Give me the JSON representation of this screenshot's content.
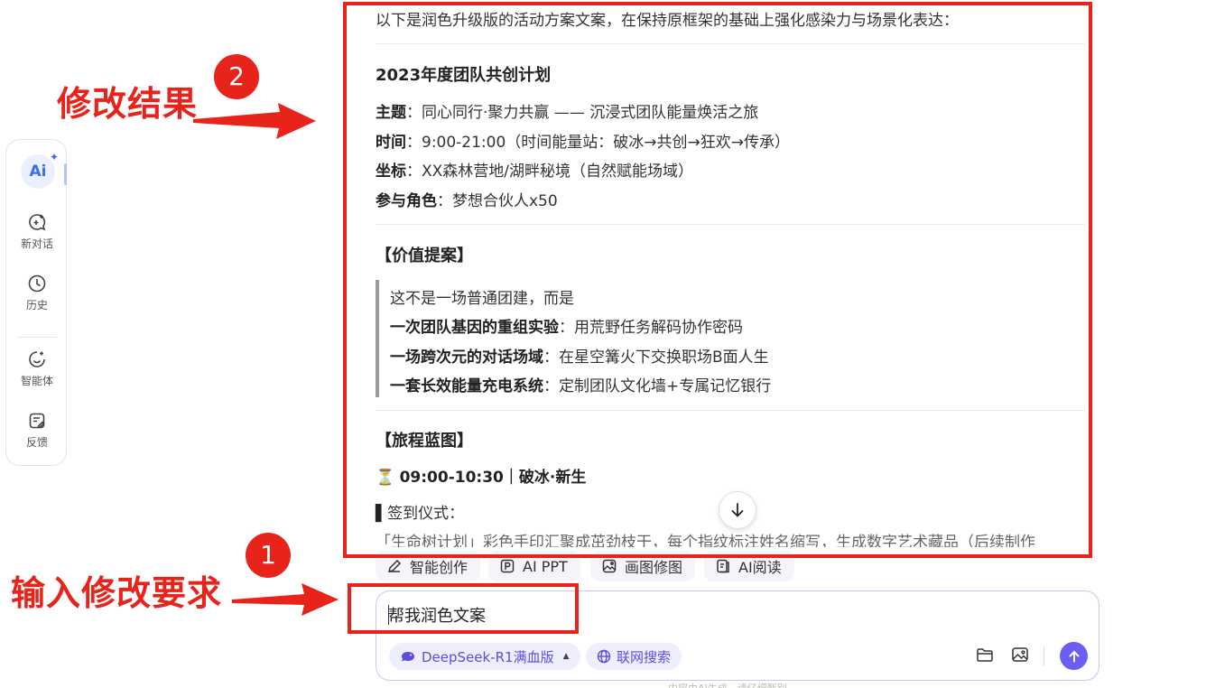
{
  "sidebar": {
    "logo": "Ai",
    "items": [
      {
        "label": "新对话",
        "icon": "new-chat-icon"
      },
      {
        "label": "历史",
        "icon": "history-icon"
      },
      {
        "label": "智能体",
        "icon": "agent-icon"
      },
      {
        "label": "反馈",
        "icon": "feedback-icon"
      }
    ]
  },
  "annotations": {
    "result_label": "修改结果",
    "result_number": "2",
    "input_label": "输入修改要求",
    "input_number": "1",
    "color": "#e8231a"
  },
  "result": {
    "intro": "以下是润色升级版的活动方案文案，在保持原框架的基础上强化感染力与场景化表达：",
    "plan_title": "2023年度团队共创计划",
    "details": [
      {
        "key": "主题",
        "value": "：同心同行·聚力共赢 —— 沉浸式团队能量焕活之旅"
      },
      {
        "key": "时间",
        "value": "：9:00-21:00（时间能量站：破冰→共创→狂欢→传承）"
      },
      {
        "key": "坐标",
        "value": "：XX森林营地/湖畔秘境（自然赋能场域）"
      },
      {
        "key": "参与角色",
        "value": "：梦想合伙人x50"
      }
    ],
    "value_heading": "【价值提案】",
    "value_intro": "这不是一场普通团建，而是",
    "value_points": [
      {
        "key": "一次团队基因的重组实验",
        "value": "：用荒野任务解码协作密码"
      },
      {
        "key": "一场跨次元的对话场域",
        "value": "：在星空篝火下交换职场B面人生"
      },
      {
        "key": "一套长效能量充电系统",
        "value": "：定制团队文化墙+专属记忆银行"
      }
    ],
    "journey_heading": "【旅程蓝图】",
    "journey_icon": "⏳",
    "journey_slot": "09:00-10:30｜破冰·新生",
    "checkin_marker": "▌",
    "checkin": "签到仪式：",
    "checkin_detail": "「生命树计划」彩色手印汇聚成茁劲枝干，每个指纹标注姓名缩写，生成数字艺术藏品（后续制作"
  },
  "quick_actions": [
    {
      "label": "智能创作",
      "icon": "pen-icon"
    },
    {
      "label": "AI PPT",
      "icon": "ppt-icon"
    },
    {
      "label": "画图修图",
      "icon": "image-edit-icon"
    },
    {
      "label": "AI阅读",
      "icon": "read-icon"
    }
  ],
  "input": {
    "value": "帮我润色文案",
    "model_label": "DeepSeek-R1满血版",
    "web_search_label": "联网搜索"
  },
  "footer_hint": "内容由AI生成，请仔细甄别",
  "colors": {
    "accent": "#6b5ef2",
    "brand_blue": "#3b6ef5",
    "annotation_red": "#e8231a"
  }
}
